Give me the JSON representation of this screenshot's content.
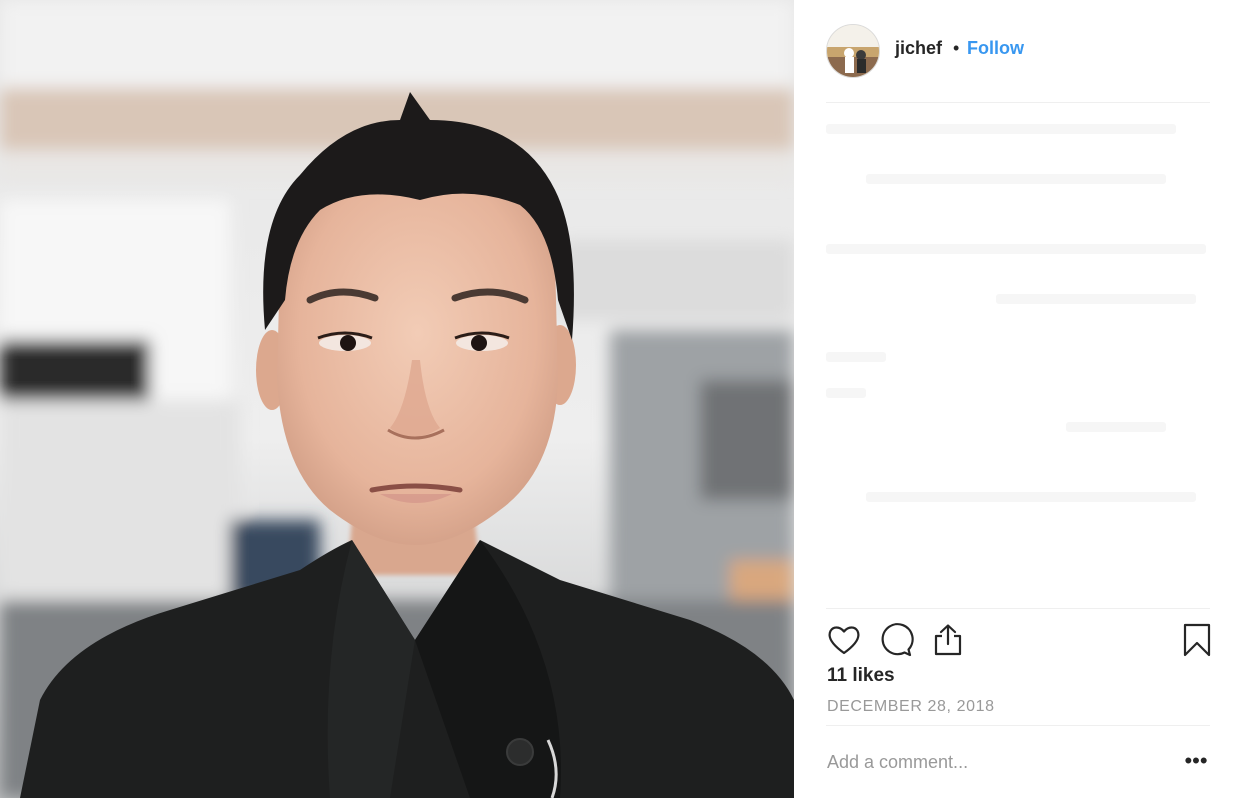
{
  "post": {
    "username": "jichef",
    "separator": "•",
    "follow_label": "Follow",
    "likes_text": "11 likes",
    "date_text": "DECEMBER 28, 2018",
    "comment_placeholder": "Add a comment...",
    "more_glyph": "•••"
  },
  "icons": {
    "like": "heart-icon",
    "comment": "comment-icon",
    "share": "share-icon",
    "save": "bookmark-icon",
    "more": "more-options-icon"
  },
  "colors": {
    "follow": "#3897f0",
    "text": "#262626",
    "muted": "#999999",
    "divider": "#efefef"
  }
}
